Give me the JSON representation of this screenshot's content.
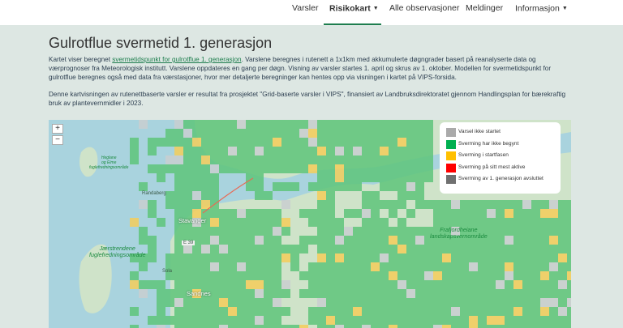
{
  "nav": {
    "items": [
      {
        "label": "Varsler"
      },
      {
        "label": "Risikokart"
      },
      {
        "label": "Alle observasjoner"
      },
      {
        "label": "Meldinger"
      },
      {
        "label": "Informasjon"
      }
    ]
  },
  "page": {
    "title": "Gulrotflue svermetid 1. generasjon",
    "intro_before_link": "Kartet viser beregnet ",
    "intro_link": "svermetidspunkt for gulrotflue 1. generasjon",
    "intro_after_link": ". Varslene beregnes i rutenett a 1x1km med akkumulerte døgngrader basert på reanalyserte data og værprognoser fra Meteorologisk institutt. Varslene oppdateres en gang per døgn. Visning av varsler startes 1. april og skrus av 1. oktober. Modellen for svermetidspunkt for gulrotflue beregnes også med data fra værstasjoner, hvor mer detaljerte beregninger kan hentes opp via visningen i kartet på VIPS-forsida.",
    "paragraph2": "Denne kartvisningen av rutenettbaserte varsler er resultat fra prosjektet \"Grid-baserte varsler i VIPS\", finansiert av Landbruksdirektoratet gjennom Handlingsplan for bærekraftig bruk av plantevernmidler i 2023."
  },
  "map": {
    "zoom_in": "+",
    "zoom_out": "−",
    "legend": [
      {
        "label": "Varsel ikke startet",
        "color": "#aaaaaa"
      },
      {
        "label": "Sverming har ikke begynt",
        "color": "#00b050"
      },
      {
        "label": "Sverming i startfasen",
        "color": "#ffc000"
      },
      {
        "label": "Sverming på sitt mest aktive",
        "color": "#ff0000"
      },
      {
        "label": "Sverming av 1. generasjon avsluttet",
        "color": "#707070"
      }
    ],
    "labels": {
      "randaberg": "Randaberg",
      "stavanger": "Stavanger",
      "sandnes": "Sandnes",
      "sola": "Sola",
      "road": "E 39",
      "jaeren": "Jærstrendene\nfuglefredningsområde",
      "frafjord": "Frafjordheiane\nlandskapsvernområde",
      "feistein": "Heglane\nog Eime\nfuglefredningsområde"
    },
    "colors": {
      "water": "#a9d3de",
      "land": "#cfe3c9",
      "grid_green": "#5ec47a",
      "grid_yellow": "#f4cd5a",
      "grid_gray": "#c9ced0"
    }
  }
}
